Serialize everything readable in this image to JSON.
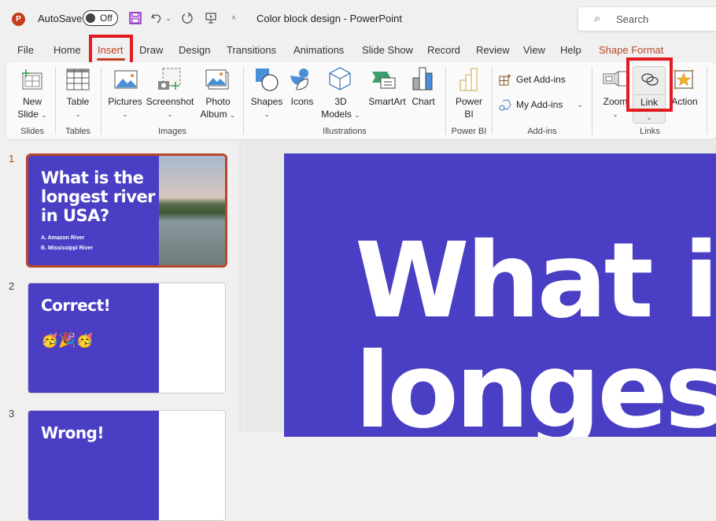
{
  "titlebar": {
    "app_icon": "powerpoint-logo",
    "app_icon_letter": "P",
    "autosave_label": "AutoSave",
    "autosave_state": "Off",
    "quick_access": [
      "save-icon",
      "undo-icon",
      "undo-dropdown-icon",
      "redo-icon",
      "present-icon",
      "customize-toolbar-icon"
    ],
    "document_title": "Color block design  -  PowerPoint",
    "search_placeholder": "Search"
  },
  "tabs": [
    {
      "label": "File"
    },
    {
      "label": "Home"
    },
    {
      "label": "Insert",
      "active": true
    },
    {
      "label": "Draw"
    },
    {
      "label": "Design"
    },
    {
      "label": "Transitions"
    },
    {
      "label": "Animations"
    },
    {
      "label": "Slide Show"
    },
    {
      "label": "Record"
    },
    {
      "label": "Review"
    },
    {
      "label": "View"
    },
    {
      "label": "Help"
    },
    {
      "label": "Shape Format",
      "contextual": true
    }
  ],
  "ribbon": {
    "groups": [
      {
        "label": "Slides",
        "buttons": [
          {
            "label_line1": "New",
            "label_line2": "Slide",
            "dropdown": true,
            "icon": "new-slide-icon"
          }
        ]
      },
      {
        "label": "Tables",
        "buttons": [
          {
            "label_line1": "Table",
            "dropdown": true,
            "icon": "table-icon"
          }
        ]
      },
      {
        "label": "Images",
        "buttons": [
          {
            "label_line1": "Pictures",
            "dropdown": true,
            "icon": "pictures-icon"
          },
          {
            "label_line1": "Screenshot",
            "dropdown": true,
            "icon": "screenshot-icon"
          },
          {
            "label_line1": "Photo",
            "label_line2": "Album",
            "dropdown": true,
            "icon": "photo-album-icon"
          }
        ]
      },
      {
        "label": "Illustrations",
        "buttons": [
          {
            "label_line1": "Shapes",
            "dropdown": true,
            "icon": "shapes-icon"
          },
          {
            "label_line1": "Icons",
            "icon": "icons-icon"
          },
          {
            "label_line1": "3D",
            "label_line2": "Models",
            "dropdown": true,
            "icon": "3d-models-icon"
          },
          {
            "label_line1": "SmartArt",
            "icon": "smartart-icon"
          },
          {
            "label_line1": "Chart",
            "icon": "chart-icon"
          }
        ]
      },
      {
        "label": "Power BI",
        "buttons": [
          {
            "label_line1": "Power",
            "label_line2": "BI",
            "icon": "power-bi-icon"
          }
        ]
      },
      {
        "label": "Add-ins",
        "buttons": [
          {
            "label_line1": "Get Add-ins",
            "icon": "get-addins-icon"
          },
          {
            "label_line1": "My Add-ins",
            "dropdown": true,
            "icon": "my-addins-icon"
          }
        ]
      },
      {
        "label": "Links",
        "buttons": [
          {
            "label_line1": "Zoom",
            "dropdown": true,
            "icon": "zoom-icon"
          },
          {
            "label_line1": "Link",
            "dropdown": true,
            "icon": "link-icon",
            "highlighted": true
          },
          {
            "label_line1": "Action",
            "icon": "action-icon"
          }
        ]
      }
    ]
  },
  "slides": [
    {
      "number": "1",
      "selected": true,
      "title": "What is the longest river in USA?",
      "title_lines": [
        "What is the",
        "longest river",
        "in USA?"
      ],
      "answers": [
        "A.  Amazon River",
        "B.  Mississippi River"
      ]
    },
    {
      "number": "2",
      "title": "Correct!",
      "emojis": "🥳🎉🥳"
    },
    {
      "number": "3",
      "title": "Wrong!"
    }
  ],
  "main_slide": {
    "line1": "What is",
    "line2": "longest"
  },
  "colors": {
    "accent": "#c43e1c",
    "slide_blue": "#4a3fc4",
    "highlight": "#e21b23"
  }
}
